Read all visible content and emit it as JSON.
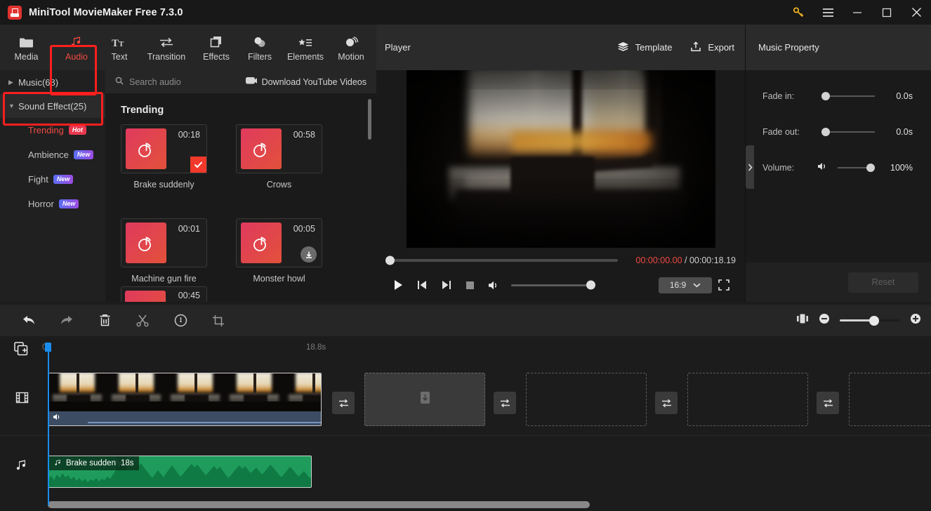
{
  "window": {
    "title": "MiniTool MovieMaker Free 7.3.0",
    "controls": [
      {
        "name": "key-icon",
        "label": ""
      },
      {
        "name": "menu-icon",
        "label": ""
      },
      {
        "name": "minimize-button",
        "label": ""
      },
      {
        "name": "maximize-button",
        "label": ""
      },
      {
        "name": "close-button",
        "label": ""
      }
    ]
  },
  "toolbar": {
    "tabs": [
      {
        "label": "Media",
        "icon": "folder-icon",
        "active": false
      },
      {
        "label": "Audio",
        "icon": "music-note-icon",
        "active": true
      },
      {
        "label": "Text",
        "icon": "text-icon",
        "active": false
      },
      {
        "label": "Transition",
        "icon": "transition-arrows-icon",
        "active": false
      },
      {
        "label": "Effects",
        "icon": "layers-icon",
        "active": false
      },
      {
        "label": "Filters",
        "icon": "filters-circles-icon",
        "active": false
      },
      {
        "label": "Elements",
        "icon": "star-list-icon",
        "active": false
      },
      {
        "label": "Motion",
        "icon": "motion-icon",
        "active": false
      }
    ],
    "highlight_color": "#ff1f1f",
    "accent_color": "#f04a42"
  },
  "categories": {
    "items": [
      {
        "label": "Music(68)",
        "expanded": false,
        "selected": false
      },
      {
        "label": "Sound Effect(25)",
        "expanded": true,
        "selected": true
      }
    ],
    "subitems": [
      {
        "label": "Trending",
        "badge": "Hot",
        "badge_type": "hot",
        "selected": true
      },
      {
        "label": "Ambience",
        "badge": "New",
        "badge_type": "new",
        "selected": false
      },
      {
        "label": "Fight",
        "badge": "New",
        "badge_type": "new",
        "selected": false
      },
      {
        "label": "Horror",
        "badge": "New",
        "badge_type": "new",
        "selected": false
      }
    ]
  },
  "audio_list": {
    "search_placeholder": "Search audio",
    "download_label": "Download YouTube Videos",
    "section_title": "Trending",
    "items": [
      {
        "name": "Brake suddenly",
        "duration": "00:18",
        "state": "selected"
      },
      {
        "name": "Crows",
        "duration": "00:58",
        "state": "none"
      },
      {
        "name": "Machine gun fire",
        "duration": "00:01",
        "state": "none"
      },
      {
        "name": "Monster howl",
        "duration": "00:05",
        "state": "download"
      }
    ],
    "partial_duration": "00:45"
  },
  "player": {
    "title": "Player",
    "template_label": "Template",
    "export_label": "Export",
    "current_time": "00:00:00.00",
    "separator": " / ",
    "total_time": "00:00:18.19",
    "aspect_ratio": "16:9",
    "progress_percent": 0,
    "volume_percent": 100
  },
  "property": {
    "title": "Music Property",
    "rows": [
      {
        "label": "Fade in:",
        "value": "0.0s",
        "percent": 0
      },
      {
        "label": "Fade out:",
        "value": "0.0s",
        "percent": 0
      },
      {
        "label": "Volume:",
        "value": "100%",
        "percent": 100
      }
    ],
    "reset_label": "Reset"
  },
  "timeline": {
    "tools": [
      {
        "name": "undo-icon",
        "label": "Undo"
      },
      {
        "name": "redo-icon",
        "label": "Redo"
      },
      {
        "name": "delete-icon",
        "label": "Delete"
      },
      {
        "name": "split-icon",
        "label": "Split"
      },
      {
        "name": "speed-icon",
        "label": "Speed"
      },
      {
        "name": "crop-icon",
        "label": "Crop"
      }
    ],
    "zoom_percent": 55,
    "ruler_start": "0s",
    "ruler_end": "18.8s",
    "video_track_icon": "film-icon",
    "audio_track_icon": "music-note-icon",
    "audio_clip": {
      "name": "Brake suddenly",
      "length": "18s"
    },
    "slots": 4,
    "transitions": 4
  }
}
